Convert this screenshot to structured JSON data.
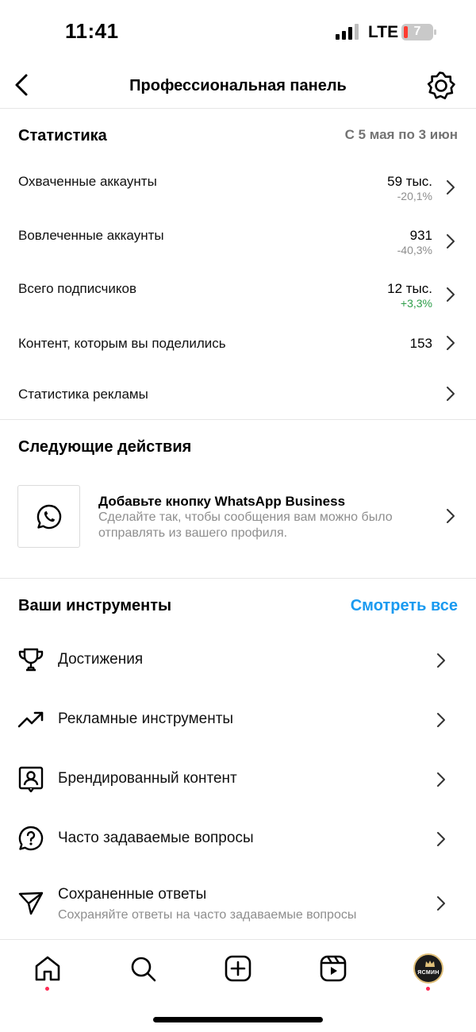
{
  "status": {
    "time": "11:41",
    "network": "LTE",
    "battery": "7"
  },
  "header": {
    "title": "Профессиональная панель"
  },
  "stats": {
    "title": "Статистика",
    "range": "С 5 мая по 3 июн",
    "rows": [
      {
        "label": "Охваченные аккаунты",
        "value": "59 тыс.",
        "change": "-20,1%"
      },
      {
        "label": "Вовлеченные аккаунты",
        "value": "931",
        "change": "-40,3%"
      },
      {
        "label": "Всего подписчиков",
        "value": "12 тыс.",
        "change": "+3,3%"
      },
      {
        "label": "Контент, которым вы поделились",
        "value": "153"
      },
      {
        "label": "Статистика рекламы"
      }
    ]
  },
  "next_actions": {
    "title": "Следующие действия",
    "card": {
      "title": "Добавьте кнопку WhatsApp Business",
      "description": "Сделайте так, чтобы сообщения вам можно было отправлять из вашего профиля.",
      "icon": "whatsapp-icon"
    }
  },
  "tools": {
    "title": "Ваши инструменты",
    "see_all": "Смотреть все",
    "see_all_color": "#1a9af0",
    "items": [
      {
        "label": "Достижения",
        "icon": "trophy-icon"
      },
      {
        "label": "Рекламные инструменты",
        "icon": "trending-icon"
      },
      {
        "label": "Брендированный контент",
        "icon": "branded-content-icon"
      },
      {
        "label": "Часто задаваемые вопросы",
        "icon": "faq-icon"
      },
      {
        "label": "Сохраненные ответы",
        "sub": "Сохраняйте ответы на часто задаваемые вопросы",
        "icon": "send-icon"
      }
    ]
  },
  "tabbar": {
    "items": [
      "home-icon",
      "search-icon",
      "create-icon",
      "reels-icon",
      "profile-avatar"
    ],
    "avatar_text": "ЯСМИН",
    "dot_color": "#ff2b55"
  },
  "colors": {
    "positive": "#2e9e4a",
    "muted": "#8e8e8e",
    "accent": "#1a9af0"
  }
}
